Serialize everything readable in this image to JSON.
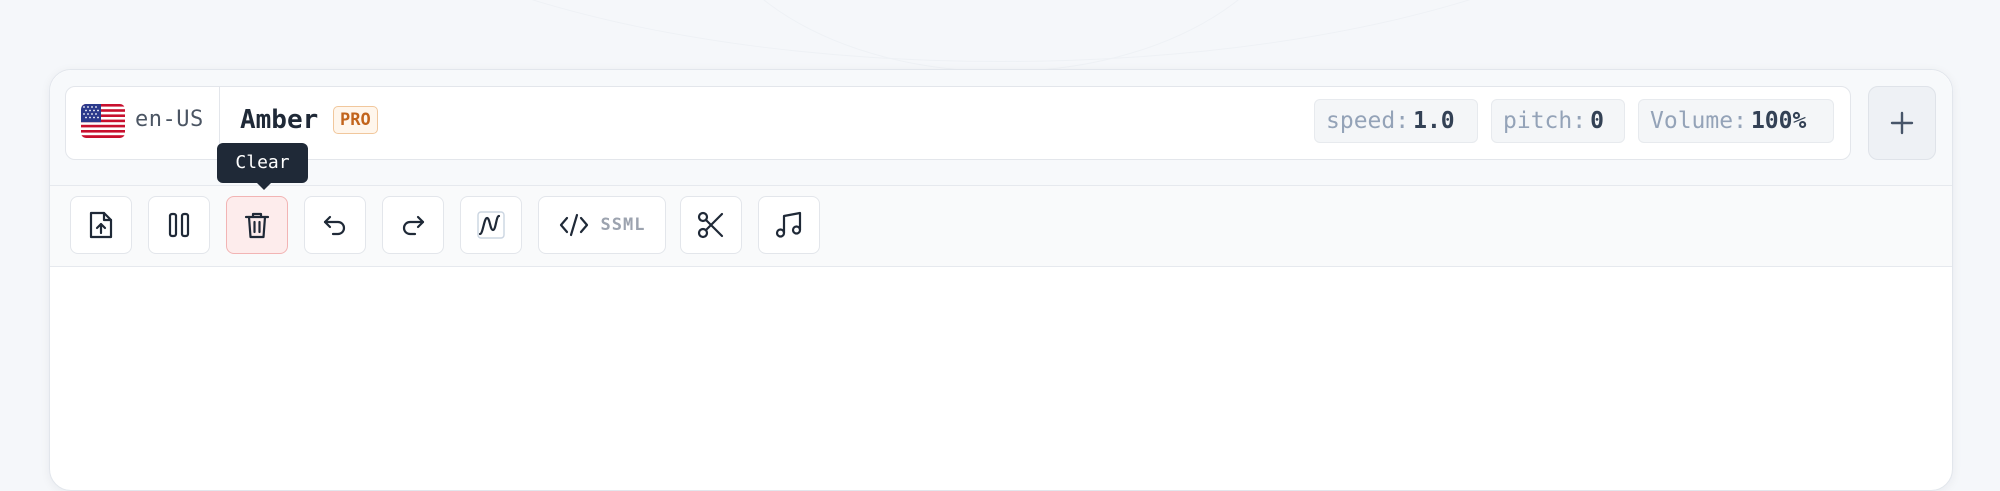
{
  "voice": {
    "locale": "en-US",
    "name": "Amber",
    "badge": "PRO",
    "speed": {
      "label": "speed:",
      "value": "1.0"
    },
    "pitch": {
      "label": "pitch:",
      "value": "0"
    },
    "volume": {
      "label": "Volume:",
      "value": "100%"
    }
  },
  "toolbar": {
    "buttons": [
      {
        "name": "upload-file-button",
        "icon": "file-upload-icon"
      },
      {
        "name": "pause-button",
        "icon": "pause-icon"
      },
      {
        "name": "clear-button",
        "icon": "trash-icon",
        "active": true
      },
      {
        "name": "undo-button",
        "icon": "undo-icon"
      },
      {
        "name": "redo-button",
        "icon": "redo-icon"
      },
      {
        "name": "waveform-button",
        "icon": "waveform-icon"
      },
      {
        "name": "ssml-button",
        "icon": "code-icon",
        "label": "SSML"
      },
      {
        "name": "cut-button",
        "icon": "scissors-icon"
      },
      {
        "name": "music-button",
        "icon": "music-note-icon"
      }
    ],
    "ssml_label": "SSML",
    "tooltip": "Clear"
  },
  "colors": {
    "accent_danger": "#fdecec",
    "badge": "#c2641c",
    "tooltip_bg": "#1f2937"
  }
}
